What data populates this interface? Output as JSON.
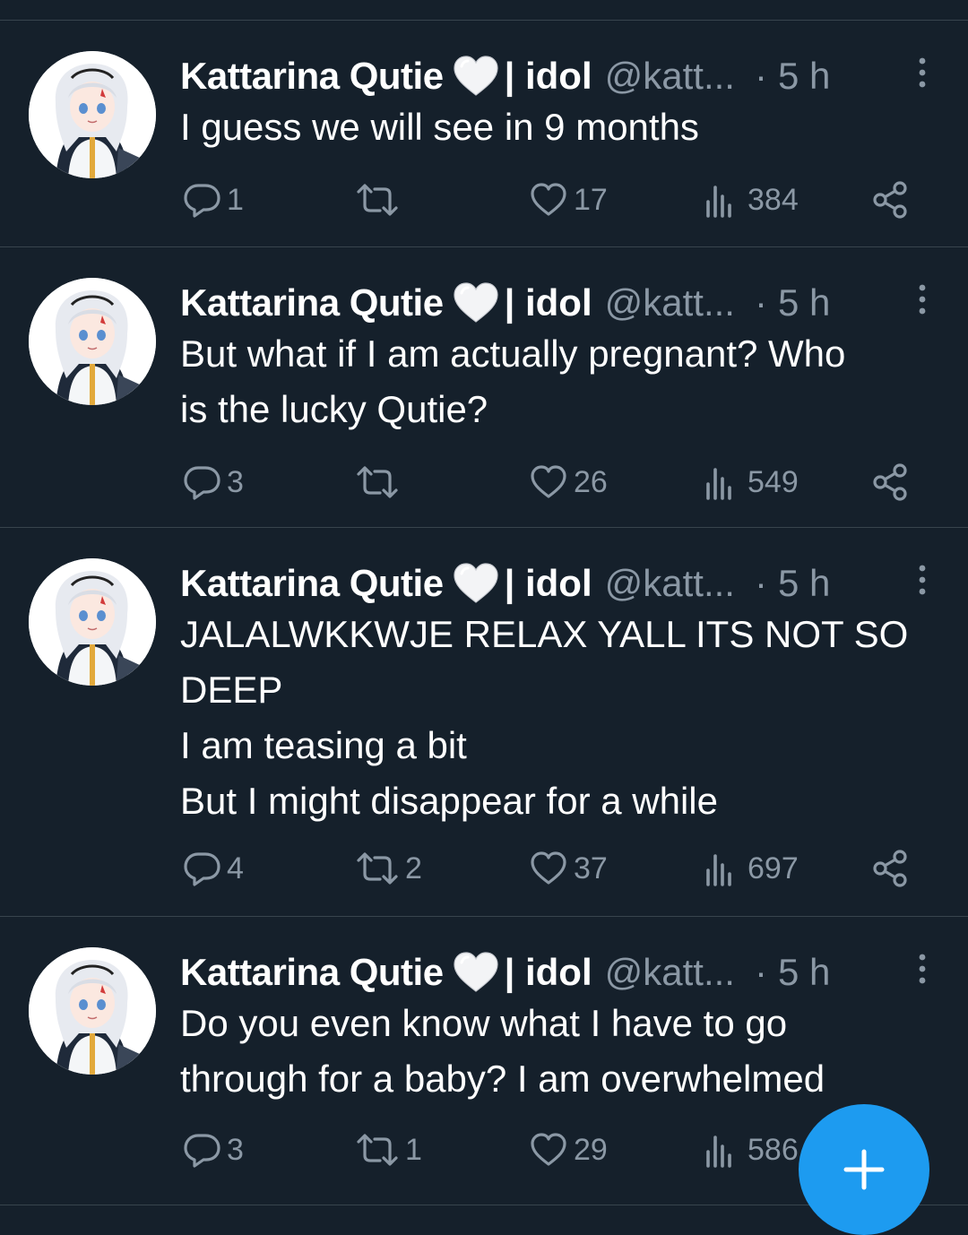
{
  "author": {
    "display_name": "Kattarina Qutie",
    "name_suffix": "| idol",
    "handle": "@katt...",
    "separator": "·"
  },
  "colors": {
    "background": "#15202b",
    "divider": "#38444d",
    "secondary_text": "#8b98a5",
    "accent": "#1d9bf0"
  },
  "tweets": [
    {
      "time": "5 h",
      "lines": [
        "I guess we will see in 9 months"
      ],
      "replies": "1",
      "retweets": "",
      "likes": "17",
      "views": "384"
    },
    {
      "time": "5 h",
      "lines": [
        "But what if I am actually pregnant? Who",
        "is the lucky Qutie?"
      ],
      "replies": "3",
      "retweets": "",
      "likes": "26",
      "views": "549"
    },
    {
      "time": "5 h",
      "lines": [
        "JALALWKKWJE RELAX YALL ITS NOT SO",
        "DEEP",
        "I am teasing a bit",
        "But I might disappear for a while"
      ],
      "replies": "4",
      "retweets": "2",
      "likes": "37",
      "views": "697"
    },
    {
      "time": "5 h",
      "lines": [
        "Do you even know what I have to go",
        "through for a baby? I am overwhelmed"
      ],
      "replies": "3",
      "retweets": "1",
      "likes": "29",
      "views": "586"
    }
  ],
  "icons": {
    "avatar": "anime-avatar-icon",
    "heart_emoji": "white-heart-emoji-icon",
    "more": "more-vertical-icon",
    "reply": "reply-icon",
    "retweet": "retweet-icon",
    "like": "like-icon",
    "views": "views-icon",
    "share": "share-icon",
    "compose": "plus-icon"
  }
}
